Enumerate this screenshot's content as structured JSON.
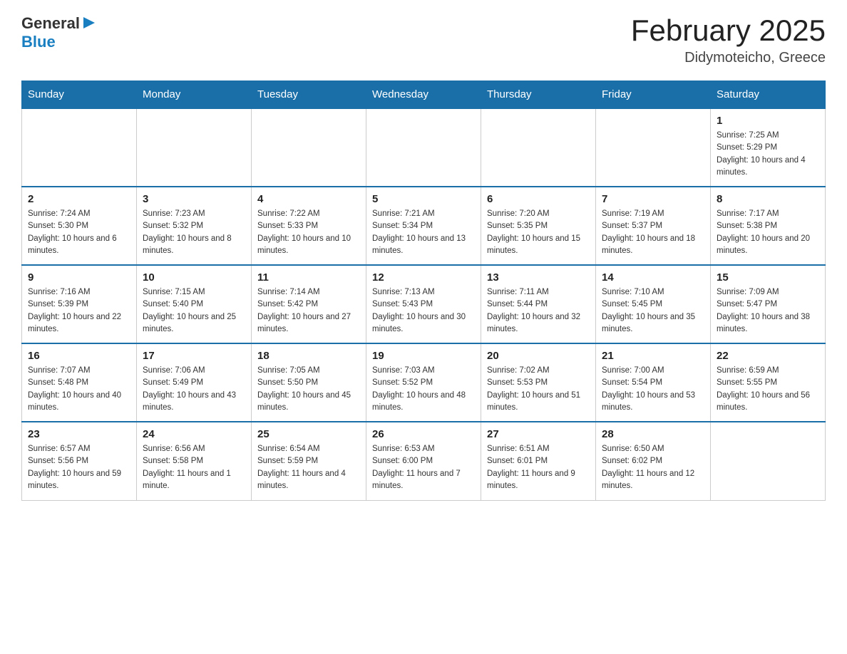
{
  "logo": {
    "general": "General",
    "blue": "Blue"
  },
  "title": {
    "month": "February 2025",
    "location": "Didymoteicho, Greece"
  },
  "weekdays": [
    "Sunday",
    "Monday",
    "Tuesday",
    "Wednesday",
    "Thursday",
    "Friday",
    "Saturday"
  ],
  "weeks": [
    [
      {
        "day": "",
        "info": ""
      },
      {
        "day": "",
        "info": ""
      },
      {
        "day": "",
        "info": ""
      },
      {
        "day": "",
        "info": ""
      },
      {
        "day": "",
        "info": ""
      },
      {
        "day": "",
        "info": ""
      },
      {
        "day": "1",
        "info": "Sunrise: 7:25 AM\nSunset: 5:29 PM\nDaylight: 10 hours and 4 minutes."
      }
    ],
    [
      {
        "day": "2",
        "info": "Sunrise: 7:24 AM\nSunset: 5:30 PM\nDaylight: 10 hours and 6 minutes."
      },
      {
        "day": "3",
        "info": "Sunrise: 7:23 AM\nSunset: 5:32 PM\nDaylight: 10 hours and 8 minutes."
      },
      {
        "day": "4",
        "info": "Sunrise: 7:22 AM\nSunset: 5:33 PM\nDaylight: 10 hours and 10 minutes."
      },
      {
        "day": "5",
        "info": "Sunrise: 7:21 AM\nSunset: 5:34 PM\nDaylight: 10 hours and 13 minutes."
      },
      {
        "day": "6",
        "info": "Sunrise: 7:20 AM\nSunset: 5:35 PM\nDaylight: 10 hours and 15 minutes."
      },
      {
        "day": "7",
        "info": "Sunrise: 7:19 AM\nSunset: 5:37 PM\nDaylight: 10 hours and 18 minutes."
      },
      {
        "day": "8",
        "info": "Sunrise: 7:17 AM\nSunset: 5:38 PM\nDaylight: 10 hours and 20 minutes."
      }
    ],
    [
      {
        "day": "9",
        "info": "Sunrise: 7:16 AM\nSunset: 5:39 PM\nDaylight: 10 hours and 22 minutes."
      },
      {
        "day": "10",
        "info": "Sunrise: 7:15 AM\nSunset: 5:40 PM\nDaylight: 10 hours and 25 minutes."
      },
      {
        "day": "11",
        "info": "Sunrise: 7:14 AM\nSunset: 5:42 PM\nDaylight: 10 hours and 27 minutes."
      },
      {
        "day": "12",
        "info": "Sunrise: 7:13 AM\nSunset: 5:43 PM\nDaylight: 10 hours and 30 minutes."
      },
      {
        "day": "13",
        "info": "Sunrise: 7:11 AM\nSunset: 5:44 PM\nDaylight: 10 hours and 32 minutes."
      },
      {
        "day": "14",
        "info": "Sunrise: 7:10 AM\nSunset: 5:45 PM\nDaylight: 10 hours and 35 minutes."
      },
      {
        "day": "15",
        "info": "Sunrise: 7:09 AM\nSunset: 5:47 PM\nDaylight: 10 hours and 38 minutes."
      }
    ],
    [
      {
        "day": "16",
        "info": "Sunrise: 7:07 AM\nSunset: 5:48 PM\nDaylight: 10 hours and 40 minutes."
      },
      {
        "day": "17",
        "info": "Sunrise: 7:06 AM\nSunset: 5:49 PM\nDaylight: 10 hours and 43 minutes."
      },
      {
        "day": "18",
        "info": "Sunrise: 7:05 AM\nSunset: 5:50 PM\nDaylight: 10 hours and 45 minutes."
      },
      {
        "day": "19",
        "info": "Sunrise: 7:03 AM\nSunset: 5:52 PM\nDaylight: 10 hours and 48 minutes."
      },
      {
        "day": "20",
        "info": "Sunrise: 7:02 AM\nSunset: 5:53 PM\nDaylight: 10 hours and 51 minutes."
      },
      {
        "day": "21",
        "info": "Sunrise: 7:00 AM\nSunset: 5:54 PM\nDaylight: 10 hours and 53 minutes."
      },
      {
        "day": "22",
        "info": "Sunrise: 6:59 AM\nSunset: 5:55 PM\nDaylight: 10 hours and 56 minutes."
      }
    ],
    [
      {
        "day": "23",
        "info": "Sunrise: 6:57 AM\nSunset: 5:56 PM\nDaylight: 10 hours and 59 minutes."
      },
      {
        "day": "24",
        "info": "Sunrise: 6:56 AM\nSunset: 5:58 PM\nDaylight: 11 hours and 1 minute."
      },
      {
        "day": "25",
        "info": "Sunrise: 6:54 AM\nSunset: 5:59 PM\nDaylight: 11 hours and 4 minutes."
      },
      {
        "day": "26",
        "info": "Sunrise: 6:53 AM\nSunset: 6:00 PM\nDaylight: 11 hours and 7 minutes."
      },
      {
        "day": "27",
        "info": "Sunrise: 6:51 AM\nSunset: 6:01 PM\nDaylight: 11 hours and 9 minutes."
      },
      {
        "day": "28",
        "info": "Sunrise: 6:50 AM\nSunset: 6:02 PM\nDaylight: 11 hours and 12 minutes."
      },
      {
        "day": "",
        "info": ""
      }
    ]
  ]
}
